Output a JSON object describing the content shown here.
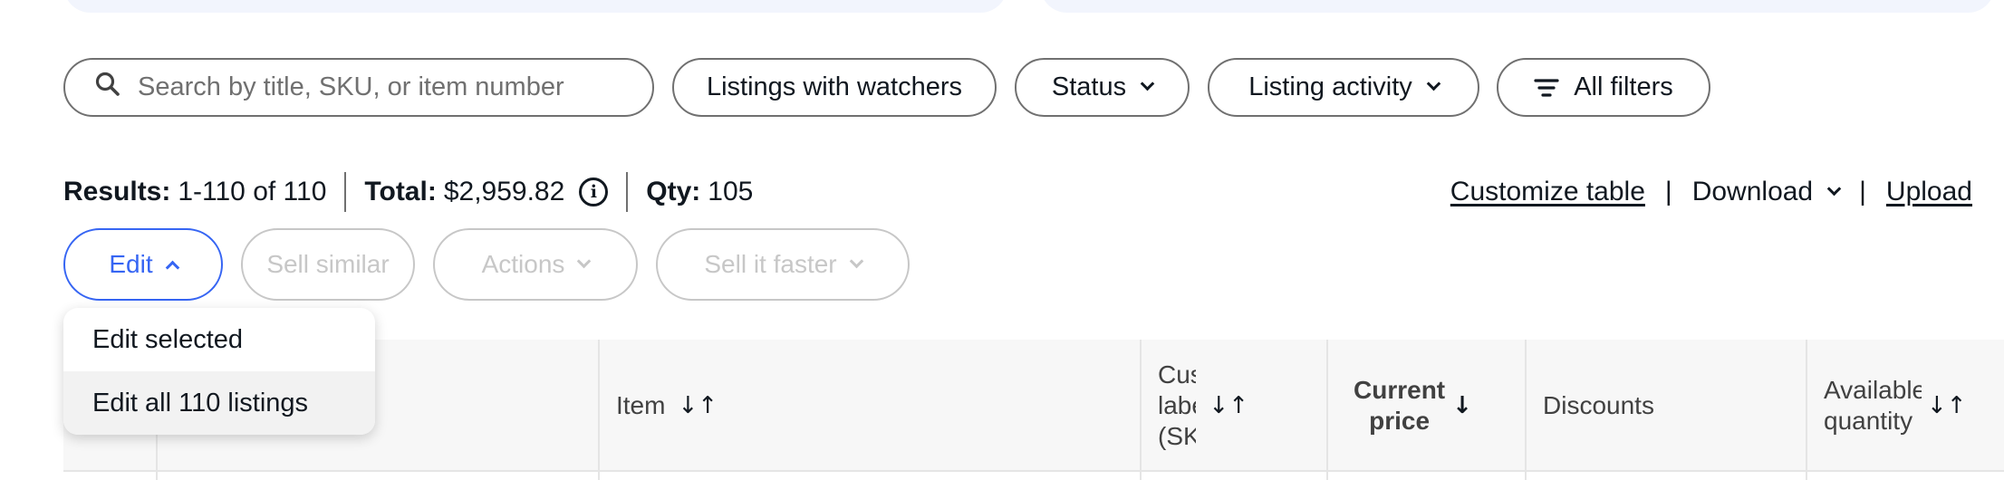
{
  "filters": {
    "search_placeholder": "Search by title, SKU, or item number",
    "watchers_label": "Listings with watchers",
    "status_label": "Status",
    "activity_label": "Listing activity",
    "all_filters_label": "All filters"
  },
  "summary": {
    "results_label": "Results:",
    "results_value": "1-110 of 110",
    "total_label": "Total:",
    "total_value": "$2,959.82",
    "info_glyph": "i",
    "qty_label": "Qty:",
    "qty_value": "105"
  },
  "links": {
    "customize": "Customize table",
    "separator": "|",
    "download": "Download",
    "upload": "Upload"
  },
  "actions": {
    "edit": "Edit",
    "sell_similar": "Sell similar",
    "actions": "Actions",
    "sell_faster": "Sell it faster"
  },
  "edit_menu": {
    "items": [
      {
        "label": "Edit selected",
        "highlighted": false
      },
      {
        "label": "Edit all 110 listings",
        "highlighted": true
      }
    ]
  },
  "table": {
    "columns": {
      "item": "Item",
      "sku_line1": "Custom",
      "sku_line2": "label",
      "sku_line3": "(SKU)",
      "price_line1": "Current",
      "price_line2": "price",
      "discounts": "Discounts",
      "avail_line1": "Available",
      "avail_line2": "quantity"
    },
    "sort_glyph": "↓↑",
    "sorted_desc_glyph": "↓"
  },
  "colors": {
    "accent": "#3665f3",
    "disabled": "#c7c7c7",
    "header_bg": "#f7f7f7"
  },
  "icons": {
    "search": "search-icon",
    "filter": "filter-lines-icon",
    "info": "info-circle-icon"
  }
}
